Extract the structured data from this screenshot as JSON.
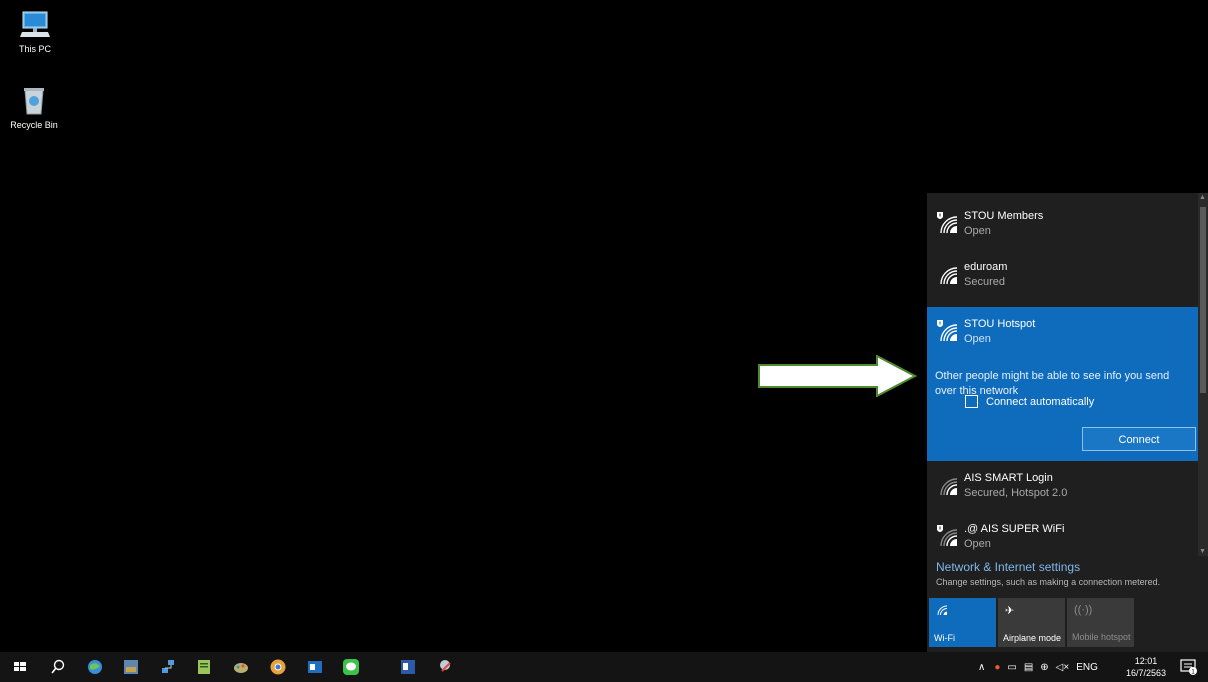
{
  "desktop": {
    "icons": [
      {
        "label": "This PC"
      },
      {
        "label": "Recycle Bin"
      }
    ]
  },
  "flyout": {
    "networks": [
      {
        "name": "STOU Members",
        "status": "Open"
      },
      {
        "name": "eduroam",
        "status": "Secured"
      },
      {
        "name": "STOU Hotspot",
        "status": "Open",
        "warning": "Other people might be able to see info you send over this network",
        "connect_automatically_label": "Connect automatically",
        "connect_automatically_checked": false,
        "connect_label": "Connect"
      },
      {
        "name": "AIS SMART Login",
        "status": "Secured, Hotspot 2.0"
      },
      {
        "name": ".@ AIS SUPER WiFi",
        "status": "Open"
      }
    ],
    "settings_link": "Network & Internet settings",
    "settings_sub": "Change settings, such as making a connection metered.",
    "tiles": [
      {
        "label": "Wi-Fi",
        "active": true
      },
      {
        "label": "Airplane mode",
        "active": false
      },
      {
        "label": "Mobile hotspot",
        "active": false,
        "disabled": true
      }
    ]
  },
  "taskbar": {
    "language": "ENG",
    "time": "12:01",
    "date": "16/7/2563",
    "notification_count": "1"
  },
  "colors": {
    "accent": "#0f6cbd",
    "arrow_fill": "#ffffff",
    "arrow_stroke": "#4e8a2e"
  }
}
